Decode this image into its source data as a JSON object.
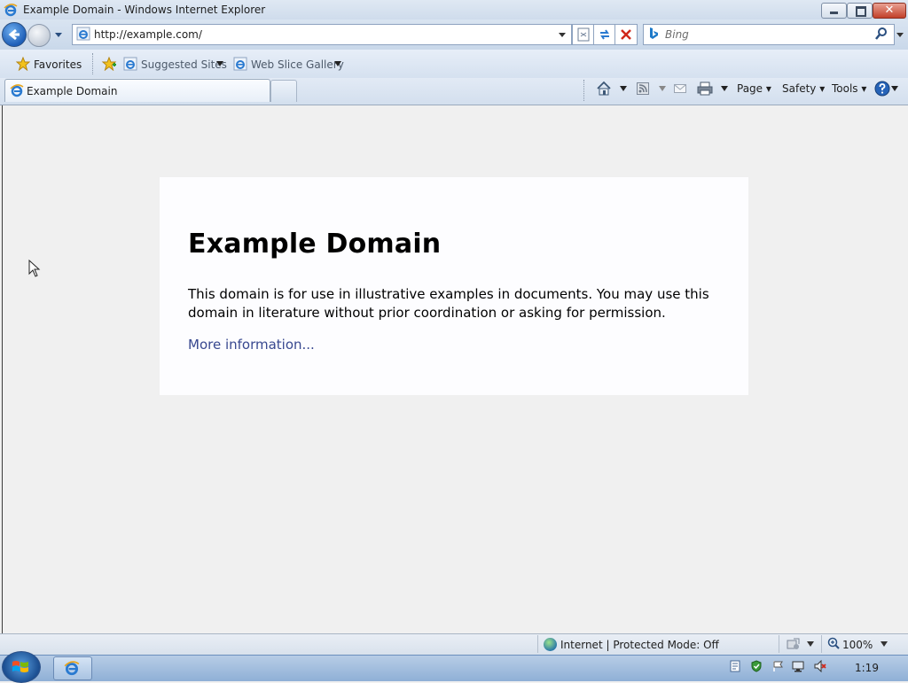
{
  "window": {
    "title": "Example Domain - Windows Internet Explorer",
    "close_glyph": "✕"
  },
  "nav": {
    "address": "http://example.com/",
    "search_placeholder": "Bing"
  },
  "favorites_bar": {
    "favorites_label": "Favorites",
    "items": [
      {
        "label": "Suggested Sites"
      },
      {
        "label": "Web Slice Gallery"
      }
    ]
  },
  "tabs": [
    {
      "label": "Example Domain"
    }
  ],
  "command_bar": {
    "page_label": "Page",
    "safety_label": "Safety",
    "tools_label": "Tools"
  },
  "page": {
    "heading": "Example Domain",
    "paragraph": "This domain is for use in illustrative examples in documents. You may use this domain in literature without prior coordination or asking for permission.",
    "link_text": "More information..."
  },
  "status_bar": {
    "zone_text": "Internet | Protected Mode: Off",
    "zoom_text": "100%"
  },
  "taskbar": {
    "clock": "1:19"
  },
  "colors": {
    "link": "#38488f",
    "chrome_blue": "#c9d8ea",
    "content_bg": "#f0f0f0",
    "card_bg": "#fdfdff"
  }
}
